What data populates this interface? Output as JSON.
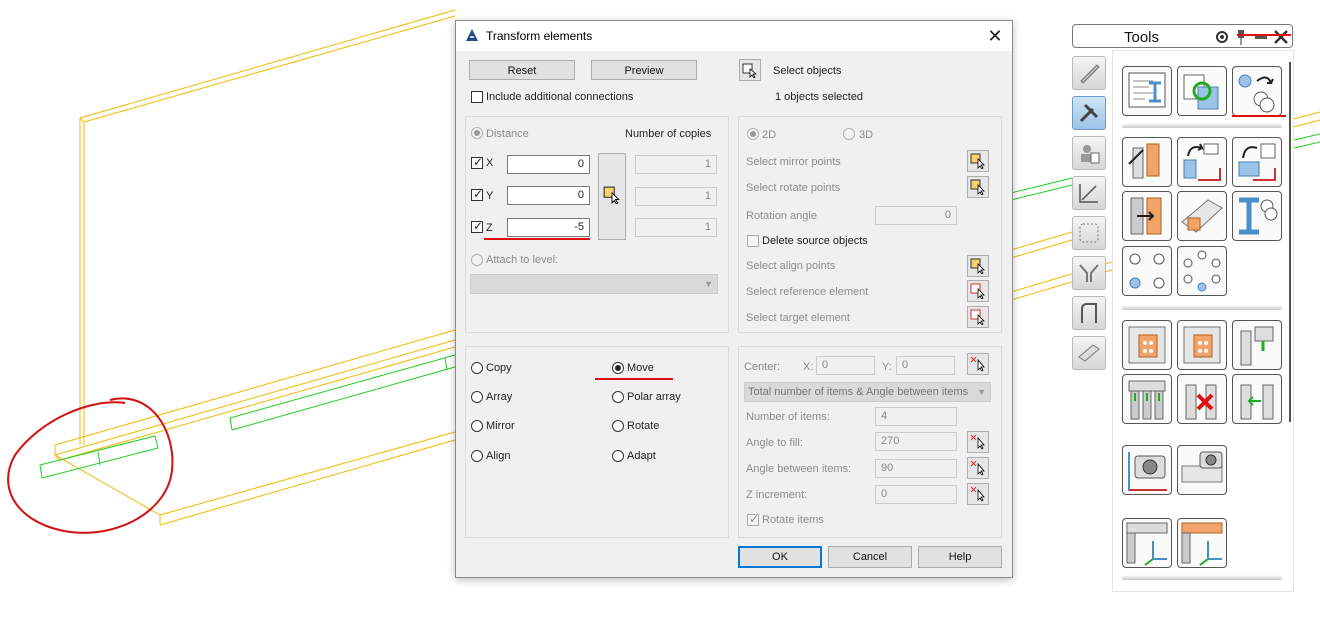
{
  "dialog": {
    "title": "Transform elements",
    "reset_label": "Reset",
    "preview_label": "Preview",
    "include_connections_label": "Include additional connections",
    "select_objects_label": "Select objects",
    "objects_selected_text": "1 objects selected",
    "distance_label": "Distance",
    "number_of_copies_label": "Number of copies",
    "x_label": "X",
    "y_label": "Y",
    "z_label": "Z",
    "x_value": "0",
    "y_value": "0",
    "z_value": "-5",
    "copies_x": "1",
    "copies_y": "1",
    "copies_z": "1",
    "attach_level_label": "Attach to level:",
    "mode_2d_label": "2D",
    "mode_3d_label": "3D",
    "select_mirror_points_label": "Select mirror points",
    "select_rotate_points_label": "Select rotate points",
    "rotation_angle_label": "Rotation angle",
    "rotation_angle_value": "0",
    "delete_source_label": "Delete source objects",
    "select_align_points_label": "Select align points",
    "select_reference_label": "Select reference element",
    "select_target_label": "Select target element",
    "operations": {
      "copy": "Copy",
      "move": "Move",
      "array": "Array",
      "polar_array": "Polar array",
      "mirror": "Mirror",
      "rotate": "Rotate",
      "align": "Align",
      "adapt": "Adapt"
    },
    "center_label": "Center:",
    "center_x_label": "X:",
    "center_x_value": "0",
    "center_y_label": "Y:",
    "center_y_value": "0",
    "array_mode_value": "Total number of items & Angle between items",
    "number_of_items_label": "Number of items:",
    "number_of_items_value": "4",
    "angle_to_fill_label": "Angle to fill:",
    "angle_to_fill_value": "270",
    "angle_between_label": "Angle between items:",
    "angle_between_value": "90",
    "z_increment_label": "Z increment:",
    "z_increment_value": "0",
    "rotate_items_label": "Rotate items",
    "ok_label": "OK",
    "cancel_label": "Cancel",
    "help_label": "Help"
  },
  "tools_panel": {
    "title": "Tools"
  },
  "colors": {
    "beam_outline": "#f2b800",
    "selected_element": "#22cc22",
    "annotation_red": "#d11111",
    "active_tab": "#9cc4e8"
  }
}
